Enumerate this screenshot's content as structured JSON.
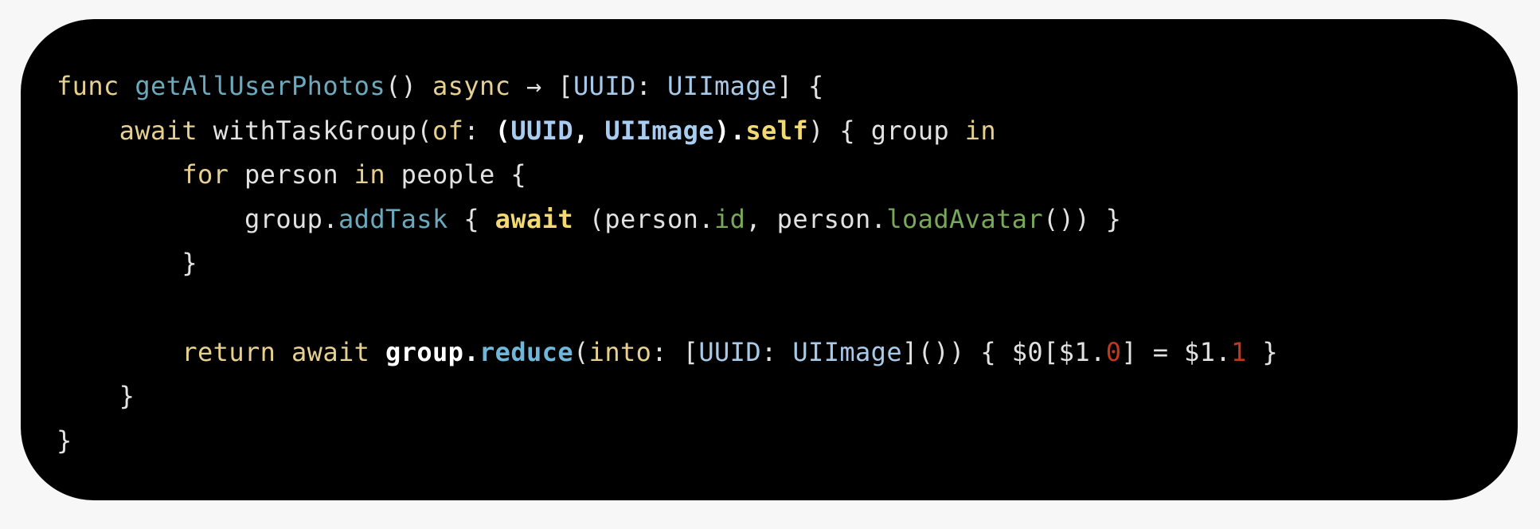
{
  "colors": {
    "background": "#000000",
    "page": "#f7f7f7",
    "keyword": "#e7d08f",
    "function_name": "#6ca9bd",
    "type": "#a9c9e8",
    "plain": "#e2e2e2",
    "property": "#78a85a",
    "numeric": "#c0381d"
  },
  "code": {
    "language": "swift",
    "lines": [
      [
        {
          "text": "func",
          "style": "keyword"
        },
        {
          "text": " ",
          "style": "plain"
        },
        {
          "text": "getAllUserPhotos",
          "style": "function"
        },
        {
          "text": "() ",
          "style": "plain"
        },
        {
          "text": "async",
          "style": "keyword"
        },
        {
          "text": " → [",
          "style": "plain"
        },
        {
          "text": "UUID",
          "style": "type"
        },
        {
          "text": ": ",
          "style": "plain"
        },
        {
          "text": "UIImage",
          "style": "type"
        },
        {
          "text": "] {",
          "style": "plain"
        }
      ],
      [
        {
          "text": "    ",
          "style": "plain"
        },
        {
          "text": "await",
          "style": "keyword"
        },
        {
          "text": " withTaskGroup(",
          "style": "plain"
        },
        {
          "text": "of",
          "style": "keyword"
        },
        {
          "text": ": ",
          "style": "plain"
        },
        {
          "text": "(",
          "style": "bold-white"
        },
        {
          "text": "UUID",
          "style": "bold-type"
        },
        {
          "text": ", ",
          "style": "bold-white"
        },
        {
          "text": "UIImage",
          "style": "bold-type"
        },
        {
          "text": ").",
          "style": "bold-white"
        },
        {
          "text": "self",
          "style": "bold-keyword"
        },
        {
          "text": ") { group ",
          "style": "plain"
        },
        {
          "text": "in",
          "style": "keyword"
        }
      ],
      [
        {
          "text": "        ",
          "style": "plain"
        },
        {
          "text": "for",
          "style": "keyword"
        },
        {
          "text": " person ",
          "style": "plain"
        },
        {
          "text": "in",
          "style": "keyword"
        },
        {
          "text": " people {",
          "style": "plain"
        }
      ],
      [
        {
          "text": "            group.",
          "style": "plain"
        },
        {
          "text": "addTask",
          "style": "function"
        },
        {
          "text": " { ",
          "style": "plain"
        },
        {
          "text": "await",
          "style": "bold-keyword"
        },
        {
          "text": " (person.",
          "style": "plain"
        },
        {
          "text": "id",
          "style": "property"
        },
        {
          "text": ", person.",
          "style": "plain"
        },
        {
          "text": "loadAvatar",
          "style": "property"
        },
        {
          "text": "()) }",
          "style": "plain"
        }
      ],
      [
        {
          "text": "        }",
          "style": "plain"
        }
      ],
      [],
      [
        {
          "text": "        ",
          "style": "plain"
        },
        {
          "text": "return",
          "style": "keyword"
        },
        {
          "text": " ",
          "style": "plain"
        },
        {
          "text": "await",
          "style": "keyword"
        },
        {
          "text": " ",
          "style": "plain"
        },
        {
          "text": "group.",
          "style": "bold-white"
        },
        {
          "text": "reduce",
          "style": "bold-function"
        },
        {
          "text": "(",
          "style": "plain"
        },
        {
          "text": "into",
          "style": "keyword"
        },
        {
          "text": ": [",
          "style": "plain"
        },
        {
          "text": "UUID",
          "style": "type"
        },
        {
          "text": ": ",
          "style": "plain"
        },
        {
          "text": "UIImage",
          "style": "type"
        },
        {
          "text": "]()) { $0[$1.",
          "style": "plain"
        },
        {
          "text": "0",
          "style": "numeric"
        },
        {
          "text": "] = $1.",
          "style": "plain"
        },
        {
          "text": "1",
          "style": "numeric"
        },
        {
          "text": " }",
          "style": "plain"
        }
      ],
      [
        {
          "text": "    }",
          "style": "plain"
        }
      ],
      [
        {
          "text": "}",
          "style": "plain"
        }
      ]
    ]
  }
}
